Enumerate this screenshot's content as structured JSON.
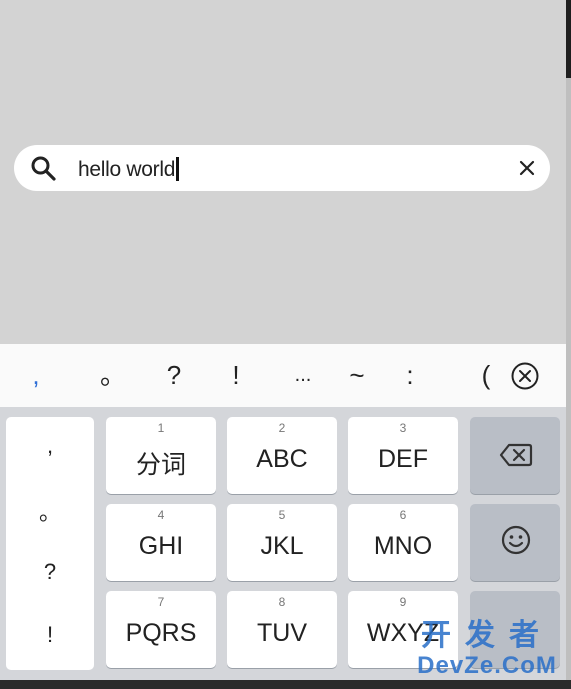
{
  "search": {
    "value": "hello world"
  },
  "symbols": {
    "comma_cn": ",",
    "period_cn": "。",
    "question": "?",
    "exclaim": "!",
    "ellipsis": "...",
    "tilde": "~",
    "colon": ":",
    "paren": "("
  },
  "side_panel": {
    "items": [
      ",",
      "。",
      "?",
      "!"
    ]
  },
  "keys": [
    {
      "num": "1",
      "label": "分词"
    },
    {
      "num": "2",
      "label": "ABC"
    },
    {
      "num": "3",
      "label": "DEF"
    },
    {
      "num": "4",
      "label": "GHI"
    },
    {
      "num": "5",
      "label": "JKL"
    },
    {
      "num": "6",
      "label": "MNO"
    },
    {
      "num": "7",
      "label": "PQRS"
    },
    {
      "num": "8",
      "label": "TUV"
    },
    {
      "num": "9",
      "label": "WXYZ"
    }
  ],
  "watermark": {
    "top": "开发者",
    "bottom": "DevZe.CoM"
  },
  "icons": {
    "search": "search-icon",
    "clear": "close-icon",
    "symbol_delete": "circle-x-icon",
    "backspace": "backspace-icon",
    "emoji": "smiley-icon"
  },
  "colors": {
    "background": "#d3d3d3",
    "keyboard": "#d4d6da",
    "function_key": "#b9bec6",
    "accent_blue": "#2f6fd6"
  }
}
